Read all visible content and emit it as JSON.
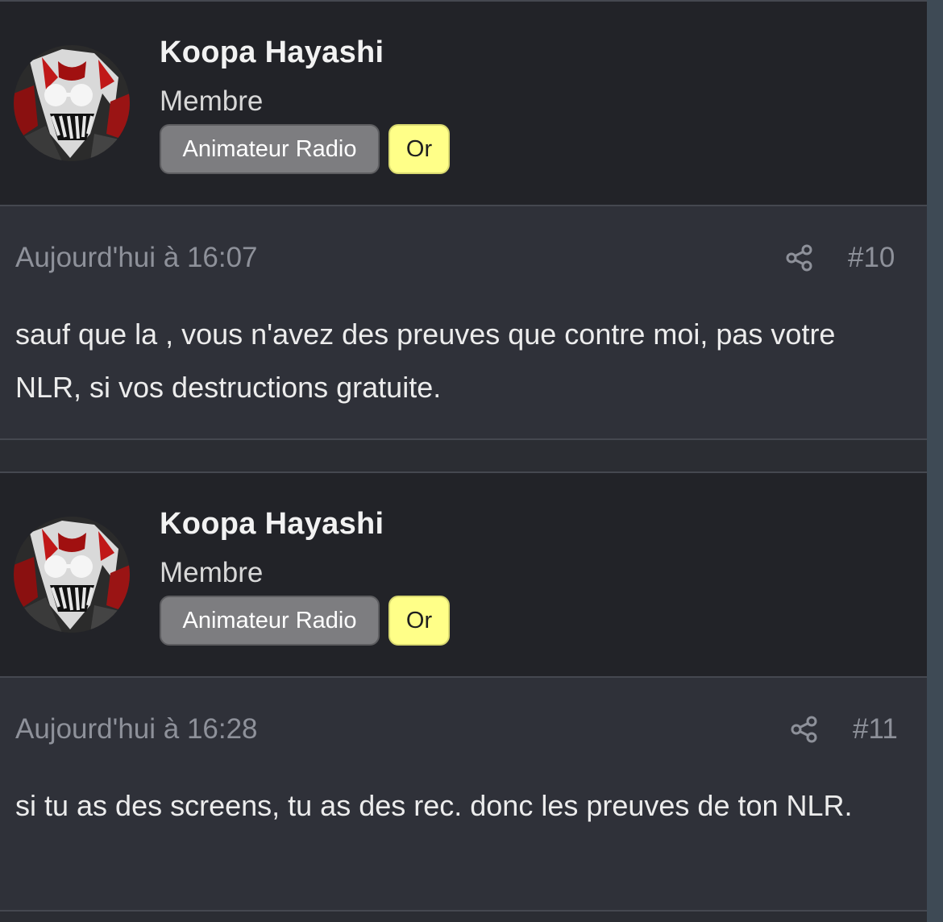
{
  "posts": [
    {
      "author": "Koopa Hayashi",
      "role": "Membre",
      "badges": [
        "Animateur Radio",
        "Or"
      ],
      "timestamp": "Aujourd'hui à 16:07",
      "number": "#10",
      "message": "sauf que la , vous n'avez des preuves que contre moi, pas votre NLR, si vos destructions gratuite.",
      "share_icon": "share-icon"
    },
    {
      "author": "Koopa Hayashi",
      "role": "Membre",
      "badges": [
        "Animateur Radio",
        "Or"
      ],
      "timestamp": "Aujourd'hui à 16:28",
      "number": "#11",
      "message": "si tu as des screens, tu as des rec. donc les preuves de ton NLR.",
      "share_icon": "share-icon"
    }
  ],
  "colors": {
    "header_bg": "#222328",
    "body_bg": "#2f3139",
    "badge_grey": "#7d7d80",
    "badge_gold": "#ffff88",
    "muted_text": "#8e919a"
  }
}
